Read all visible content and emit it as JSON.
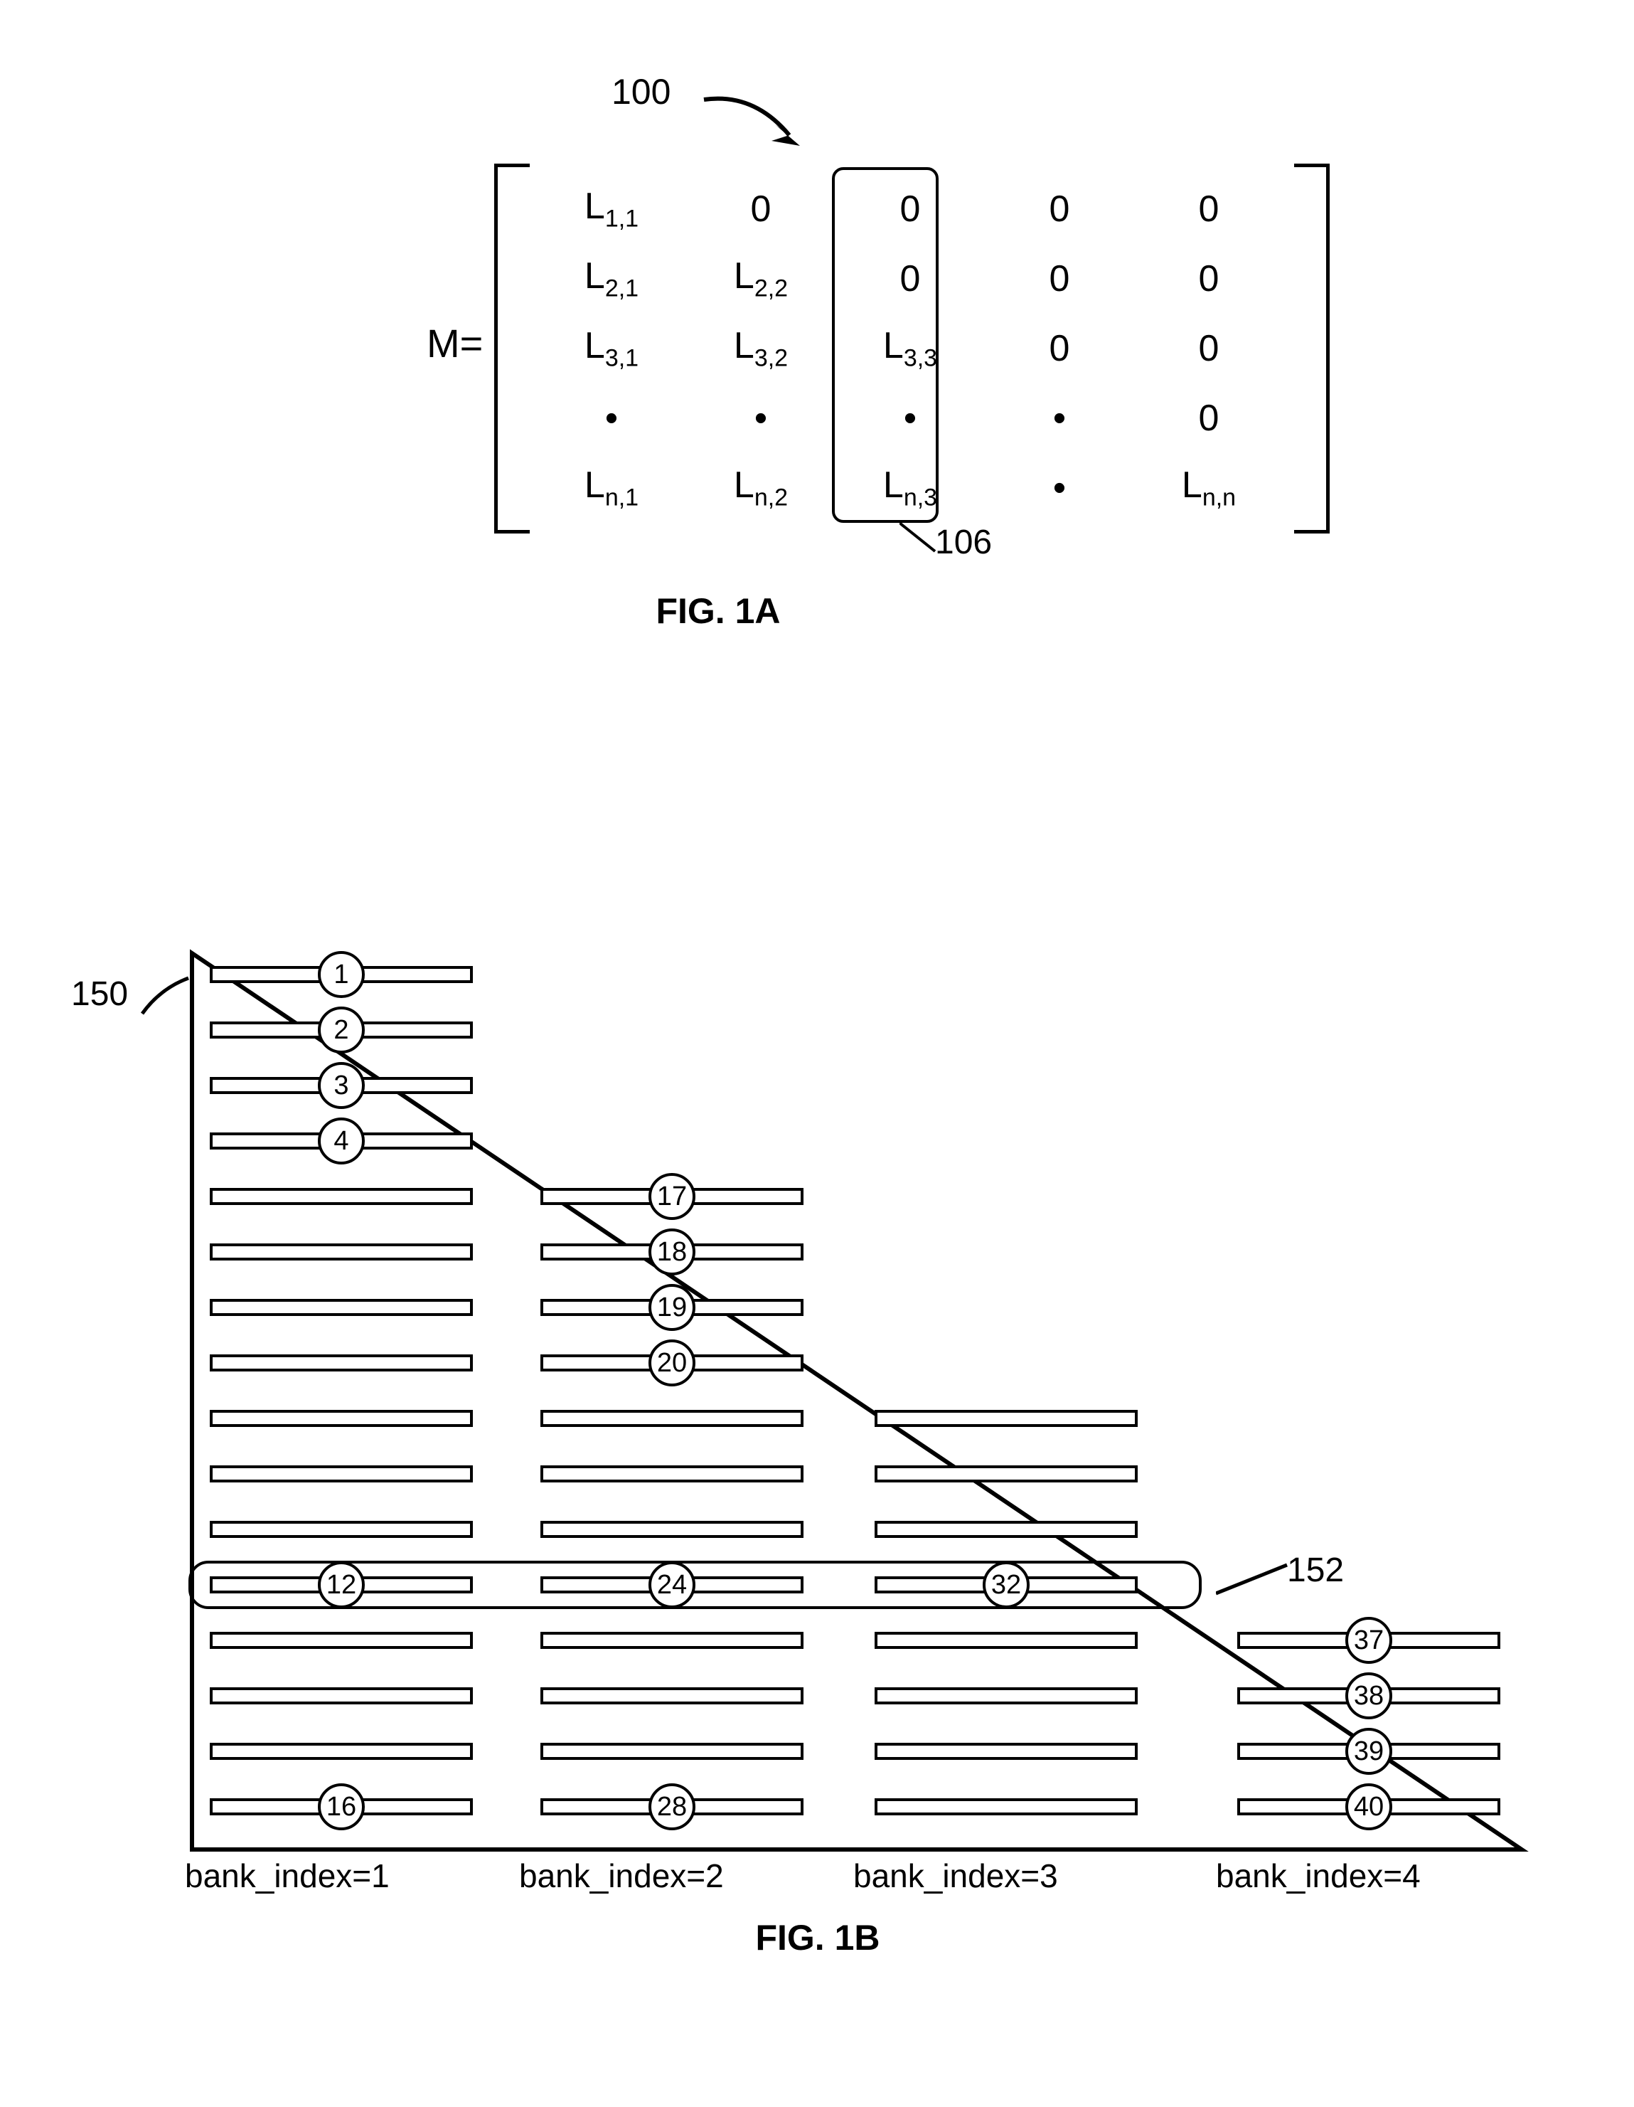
{
  "refs": {
    "r100": "100",
    "r106": "106",
    "r150": "150",
    "r152": "152"
  },
  "fig1a": {
    "caption": "FIG. 1A",
    "m_eq": "M=",
    "cells": [
      [
        "L",
        "1,1",
        "0",
        "",
        "0",
        "",
        "0",
        "",
        "0",
        ""
      ],
      [
        "L",
        "2,1",
        "L",
        "2,2",
        "0",
        "",
        "0",
        "",
        "0",
        ""
      ],
      [
        "L",
        "3,1",
        "L",
        "3,2",
        "L",
        "3,3",
        "0",
        "",
        "0",
        ""
      ],
      [
        "•",
        "",
        "•",
        "",
        "•",
        "",
        "•",
        "",
        "0",
        ""
      ],
      [
        "L",
        "n,1",
        "L",
        "n,2",
        "L",
        "n,3",
        "•",
        "",
        "L",
        "n,n"
      ]
    ]
  },
  "fig1b": {
    "caption": "FIG. 1B",
    "bank_labels": [
      "bank_index=1",
      "bank_index=2",
      "bank_index=3",
      "bank_index=4"
    ],
    "bubbles": {
      "col1_top": [
        "1",
        "2",
        "3",
        "4"
      ],
      "col2_top": [
        "17",
        "18",
        "19",
        "20"
      ],
      "row12": [
        "12",
        "24",
        "32"
      ],
      "row16": [
        "16",
        "28"
      ],
      "col4": [
        "37",
        "38",
        "39",
        "40"
      ]
    }
  }
}
